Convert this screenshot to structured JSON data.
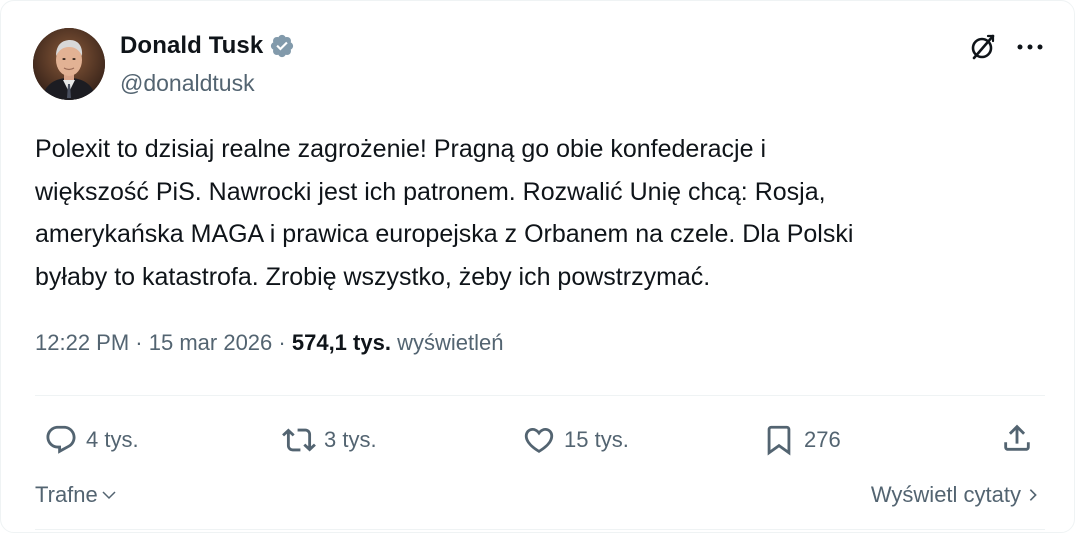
{
  "author": {
    "name": "Donald Tusk",
    "handle": "@donaldtusk",
    "verified_color": "#829aab"
  },
  "header_icons": [
    "grok-icon",
    "more-icon"
  ],
  "tweet": {
    "lines": [
      "Polexit to dzisiaj realne zagrożenie! Pragną go obie konfederacje i",
      "większość PiS. Nawrocki jest ich patronem. Rozwalić Unię chcą: Rosja,",
      "amerykańska MAGA i prawica europejska z Orbanem na czele. Dla Polski",
      "byłaby to katastrofa. Zrobię wszystko, żeby ich powstrzymać."
    ]
  },
  "meta": {
    "time": "12:22 PM",
    "separator": "·",
    "date": "15 mar 2026",
    "views_count": "574,1 tys.",
    "views_label": "wyświetleń"
  },
  "actions": {
    "replies": "4 tys.",
    "reposts": "3 tys.",
    "likes": "15 tys.",
    "bookmarks": "276"
  },
  "footer": {
    "sort_label": "Trafne",
    "quotes_label": "Wyświetl cytaty"
  },
  "colors": {
    "text": "#0f1419",
    "secondary": "#536471",
    "divider": "#eff3f4"
  }
}
